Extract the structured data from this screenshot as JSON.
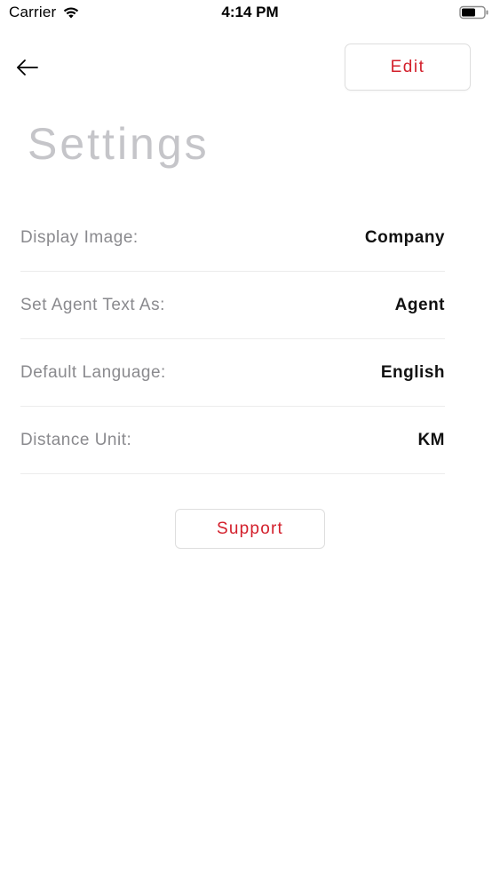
{
  "status_bar": {
    "carrier": "Carrier",
    "time": "4:14 PM",
    "wifi_icon": "wifi-icon",
    "battery_icon": "battery-icon"
  },
  "header": {
    "back_icon": "arrow-left-icon",
    "edit_label": "Edit",
    "title": "Settings"
  },
  "settings": {
    "rows": [
      {
        "label": "Display Image:",
        "value": "Company"
      },
      {
        "label": "Set Agent Text As:",
        "value": "Agent"
      },
      {
        "label": "Default Language:",
        "value": "English"
      },
      {
        "label": "Distance Unit:",
        "value": "KM"
      }
    ]
  },
  "support_label": "Support",
  "colors": {
    "accent": "#d31f2b",
    "title_gray": "#c5c5c9",
    "label_gray": "#8a8a8e",
    "divider": "#ececec"
  }
}
